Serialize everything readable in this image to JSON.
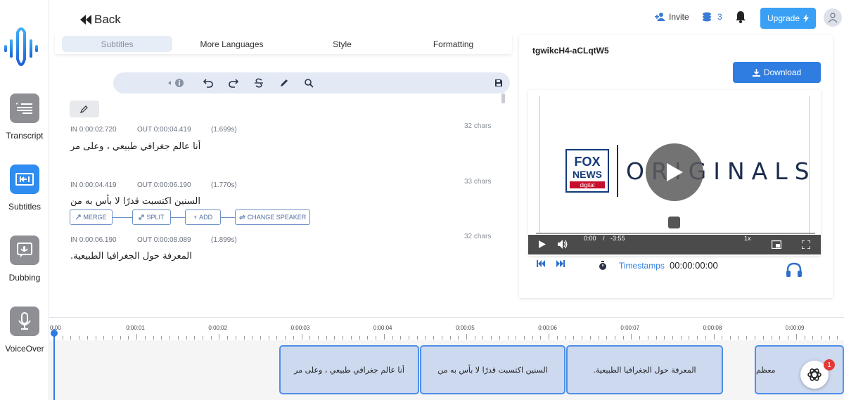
{
  "header": {
    "back_label": "Back",
    "invite_label": "Invite",
    "credits_count": "3",
    "upgrade_label": "Upgrade"
  },
  "sidebar": {
    "items": [
      {
        "label": "Transcript",
        "icon": "transcript-icon",
        "active": false
      },
      {
        "label": "Subtitles",
        "icon": "subtitles-icon",
        "active": true
      },
      {
        "label": "Dubbing",
        "icon": "dubbing-icon",
        "active": false
      },
      {
        "label": "VoiceOver",
        "icon": "microphone-icon",
        "active": false
      }
    ]
  },
  "tabs": [
    {
      "label": "Subtitles",
      "active": true
    },
    {
      "label": "More Languages",
      "active": false
    },
    {
      "label": "Style",
      "active": false
    },
    {
      "label": "Formatting",
      "active": false
    }
  ],
  "subtitles": [
    {
      "in": "IN 0:00:02.720",
      "out": "OUT 0:00:04.419",
      "duration": "(1.699s)",
      "chars": "32 chars",
      "text": "أنا عالم جغرافي طبيعي ، وعلى مر"
    },
    {
      "in": "IN 0:00:04.419",
      "out": "OUT 0:00:06.190",
      "duration": "(1.770s)",
      "chars": "33 chars",
      "text": "السنين اكتسبت قدرًا لا بأس به من"
    },
    {
      "in": "IN 0:00:06.190",
      "out": "OUT 0:00:08.089",
      "duration": "(1.899s)",
      "chars": "32 chars",
      "text": "المعرفة حول الجغرافيا الطبيعية."
    }
  ],
  "row_actions": {
    "merge": "MERGE",
    "split": "SPLIT",
    "add": "ADD",
    "change_speaker": "CHANGE SPEAKER"
  },
  "video": {
    "file_id": "tgwikcH4-aCLqtW5",
    "download_label": "Download",
    "brand_text": "ORIGINALS",
    "fox_top": "FOX",
    "fox_mid": "NEWS",
    "fox_bottom": "digital",
    "current_time": "0:00",
    "separator": "/",
    "remaining_time": "-3:55",
    "speed": "1x",
    "timestamps_label": "Timestamps",
    "timestamp_value": "00:00:00:00"
  },
  "timeline": {
    "ticks": [
      "0:00",
      "0:00:01",
      "0:00:02",
      "0:00:03",
      "0:00:04",
      "0:00:05",
      "0:00:06",
      "0:00:07",
      "0:00:08",
      "0:00:09"
    ],
    "clips": [
      "أنا عالم جغرافي طبيعي ، وعلى مر",
      "السنين اكتسبت قدرًا لا بأس به من",
      "المعرفة حول الجغرافيا الطبيعية.",
      "معظم"
    ]
  },
  "chat": {
    "badge": "1"
  },
  "colors": {
    "accent": "#2f7de1",
    "sidebar_active": "#2f8cf0",
    "clip_bg": "#cdd9ef",
    "clip_border": "#4e8ee8"
  }
}
